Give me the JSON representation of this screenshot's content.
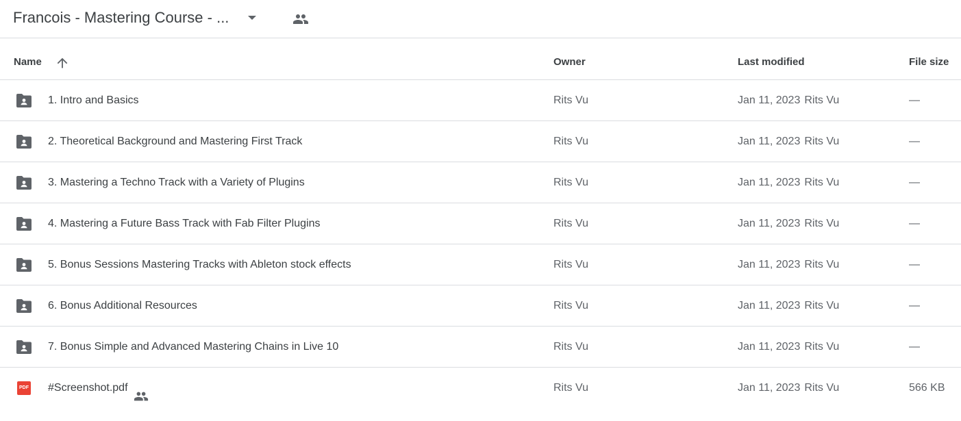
{
  "header": {
    "folder_title": "Francois - Mastering Course - ...",
    "icons": {
      "dropdown": "arrow-drop-down-icon",
      "shared": "shared-people-icon"
    }
  },
  "columns": {
    "name": "Name",
    "owner": "Owner",
    "last_modified": "Last modified",
    "file_size": "File size",
    "sort": "ascending"
  },
  "colors": {
    "folder_icon": "#5f6368",
    "pdf_icon": "#ea4335",
    "divider": "#dadce0"
  },
  "rows": [
    {
      "type": "folder",
      "name": "1. Intro and Basics",
      "owner": "Rits Vu",
      "modified_date": "Jan 11, 2023",
      "modified_by": "Rits Vu",
      "size": "—",
      "shared": false
    },
    {
      "type": "folder",
      "name": "2. Theoretical Background and Mastering First Track",
      "owner": "Rits Vu",
      "modified_date": "Jan 11, 2023",
      "modified_by": "Rits Vu",
      "size": "—",
      "shared": false
    },
    {
      "type": "folder",
      "name": "3. Mastering a Techno Track with a Variety of Plugins",
      "owner": "Rits Vu",
      "modified_date": "Jan 11, 2023",
      "modified_by": "Rits Vu",
      "size": "—",
      "shared": false
    },
    {
      "type": "folder",
      "name": "4. Mastering a Future Bass Track with Fab Filter Plugins",
      "owner": "Rits Vu",
      "modified_date": "Jan 11, 2023",
      "modified_by": "Rits Vu",
      "size": "—",
      "shared": false
    },
    {
      "type": "folder",
      "name": "5. Bonus Sessions Mastering Tracks with Ableton stock effects",
      "owner": "Rits Vu",
      "modified_date": "Jan 11, 2023",
      "modified_by": "Rits Vu",
      "size": "—",
      "shared": false
    },
    {
      "type": "folder",
      "name": "6. Bonus Additional Resources",
      "owner": "Rits Vu",
      "modified_date": "Jan 11, 2023",
      "modified_by": "Rits Vu",
      "size": "—",
      "shared": false
    },
    {
      "type": "folder",
      "name": "7. Bonus Simple and Advanced Mastering Chains in Live 10",
      "owner": "Rits Vu",
      "modified_date": "Jan 11, 2023",
      "modified_by": "Rits Vu",
      "size": "—",
      "shared": false
    },
    {
      "type": "pdf",
      "name": "#Screenshot.pdf",
      "icon_label": "PDF",
      "owner": "Rits Vu",
      "modified_date": "Jan 11, 2023",
      "modified_by": "Rits Vu",
      "size": "566 KB",
      "shared": true
    }
  ]
}
